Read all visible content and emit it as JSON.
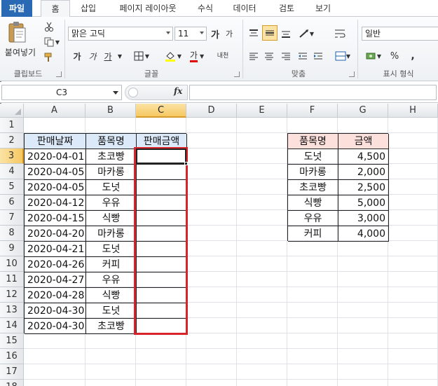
{
  "ribbon": {
    "tabs": [
      "파일",
      "홈",
      "삽입",
      "페이지 레이아웃",
      "수식",
      "데이터",
      "검토",
      "보기"
    ],
    "active_tab": "홈",
    "clipboard": {
      "paste_label": "붙여넣기",
      "group_label": "클립보드"
    },
    "font": {
      "name": "맑은 고딕",
      "size": "11",
      "bold_glyph": "가",
      "italic_glyph": "가",
      "underline_glyph": "가",
      "color_glyph": "가",
      "phonetic_glyph": "내천",
      "grow_glyph": "가",
      "shrink_glyph": "가",
      "group_label": "글꼴"
    },
    "alignment": {
      "group_label": "맞춤"
    },
    "number": {
      "format": "일반",
      "percent": "%",
      "comma": ",",
      "group_label": "표시 형식"
    }
  },
  "formula_bar": {
    "name_box": "C3",
    "fx": "fx",
    "formula": ""
  },
  "grid": {
    "columns": [
      "A",
      "B",
      "C",
      "D",
      "E",
      "F",
      "G",
      "H"
    ],
    "rows": [
      "1",
      "2",
      "3",
      "4",
      "5",
      "6",
      "7",
      "8",
      "9",
      "10",
      "11",
      "12",
      "13",
      "14",
      "15",
      "16",
      "17",
      "18"
    ],
    "selected_column": "C",
    "selected_row": "3"
  },
  "sales_table": {
    "headers": [
      "판매날짜",
      "품목명",
      "판매금액"
    ],
    "rows": [
      {
        "date": "2020-04-01",
        "item": "초코빵",
        "amount": ""
      },
      {
        "date": "2020-04-05",
        "item": "마카롱",
        "amount": ""
      },
      {
        "date": "2020-04-05",
        "item": "도넛",
        "amount": ""
      },
      {
        "date": "2020-04-12",
        "item": "우유",
        "amount": ""
      },
      {
        "date": "2020-04-15",
        "item": "식빵",
        "amount": ""
      },
      {
        "date": "2020-04-20",
        "item": "마카롱",
        "amount": ""
      },
      {
        "date": "2020-04-21",
        "item": "도넛",
        "amount": ""
      },
      {
        "date": "2020-04-26",
        "item": "커피",
        "amount": ""
      },
      {
        "date": "2020-04-27",
        "item": "우유",
        "amount": ""
      },
      {
        "date": "2020-04-28",
        "item": "식빵",
        "amount": ""
      },
      {
        "date": "2020-04-30",
        "item": "도넛",
        "amount": ""
      },
      {
        "date": "2020-04-30",
        "item": "초코빵",
        "amount": ""
      }
    ]
  },
  "price_table": {
    "headers": [
      "품목명",
      "금액"
    ],
    "rows": [
      {
        "item": "도넛",
        "price": "4,500"
      },
      {
        "item": "마카롱",
        "price": "2,000"
      },
      {
        "item": "초코빵",
        "price": "2,500"
      },
      {
        "item": "식빵",
        "price": "5,000"
      },
      {
        "item": "우유",
        "price": "3,000"
      },
      {
        "item": "커피",
        "price": "4,000"
      }
    ]
  },
  "colors": {
    "header_blue": "#dce9f8",
    "header_pink": "#fce0dc",
    "selection_red": "#d8232a",
    "file_tab": "#2a6ab5"
  }
}
